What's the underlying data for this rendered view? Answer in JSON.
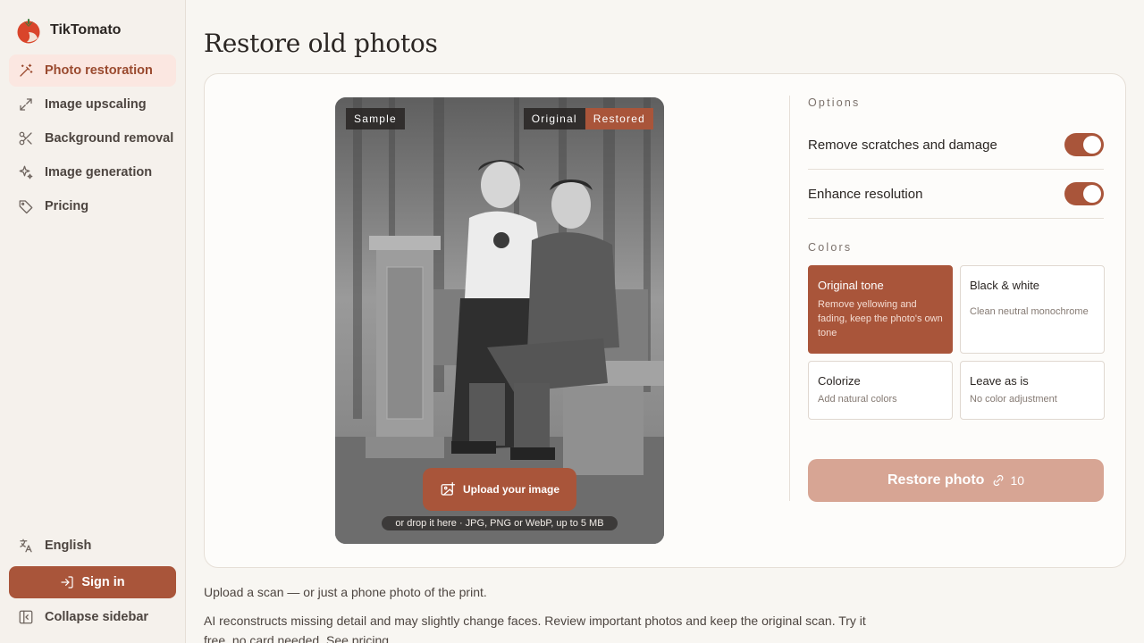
{
  "brand": {
    "name": "TikTomato"
  },
  "sidebar": {
    "items": [
      {
        "label": "Photo restoration",
        "icon": "magic-wand-icon",
        "active": true
      },
      {
        "label": "Image upscaling",
        "icon": "expand-arrows-icon"
      },
      {
        "label": "Background removal",
        "icon": "scissors-icon"
      },
      {
        "label": "Image generation",
        "icon": "sparkles-icon"
      },
      {
        "label": "Pricing",
        "icon": "tag-icon"
      }
    ],
    "language": "English",
    "sign_in": "Sign in",
    "collapse": "Collapse sidebar"
  },
  "main": {
    "title": "Restore old photos",
    "preview": {
      "sample_tag": "Sample",
      "original_tab": "Original",
      "restored_tab": "Restored",
      "upload_label": "Upload your image",
      "drop_hint": "or drop it here · JPG, PNG or WebP, up to 5 MB"
    },
    "options": {
      "section_label": "Options",
      "toggles": [
        {
          "label": "Remove scratches and damage",
          "on": true
        },
        {
          "label": "Enhance resolution",
          "on": true
        }
      ],
      "colors_label": "Colors",
      "colors": [
        {
          "title": "Original tone",
          "desc": "Remove yellowing and fading, keep the photo's own tone",
          "selected": true
        },
        {
          "title": "Black & white",
          "desc": "Clean neutral monochrome"
        },
        {
          "title": "Colorize",
          "desc": "Add natural colors"
        },
        {
          "title": "Leave as is",
          "desc": "No color adjustment"
        }
      ],
      "restore_label": "Restore photo",
      "credits": "10"
    },
    "footnote_1": "Upload a scan — or just a phone photo of the print.",
    "footnote_2": "AI reconstructs missing detail and may slightly change faces. Review important photos and keep the original scan. Try it free, no card needed.",
    "footnote_link": "See pricing"
  },
  "colors": {
    "accent": "#a9553a",
    "accent_soft": "#fbe7e1",
    "disabled_button": "#d7a594"
  }
}
